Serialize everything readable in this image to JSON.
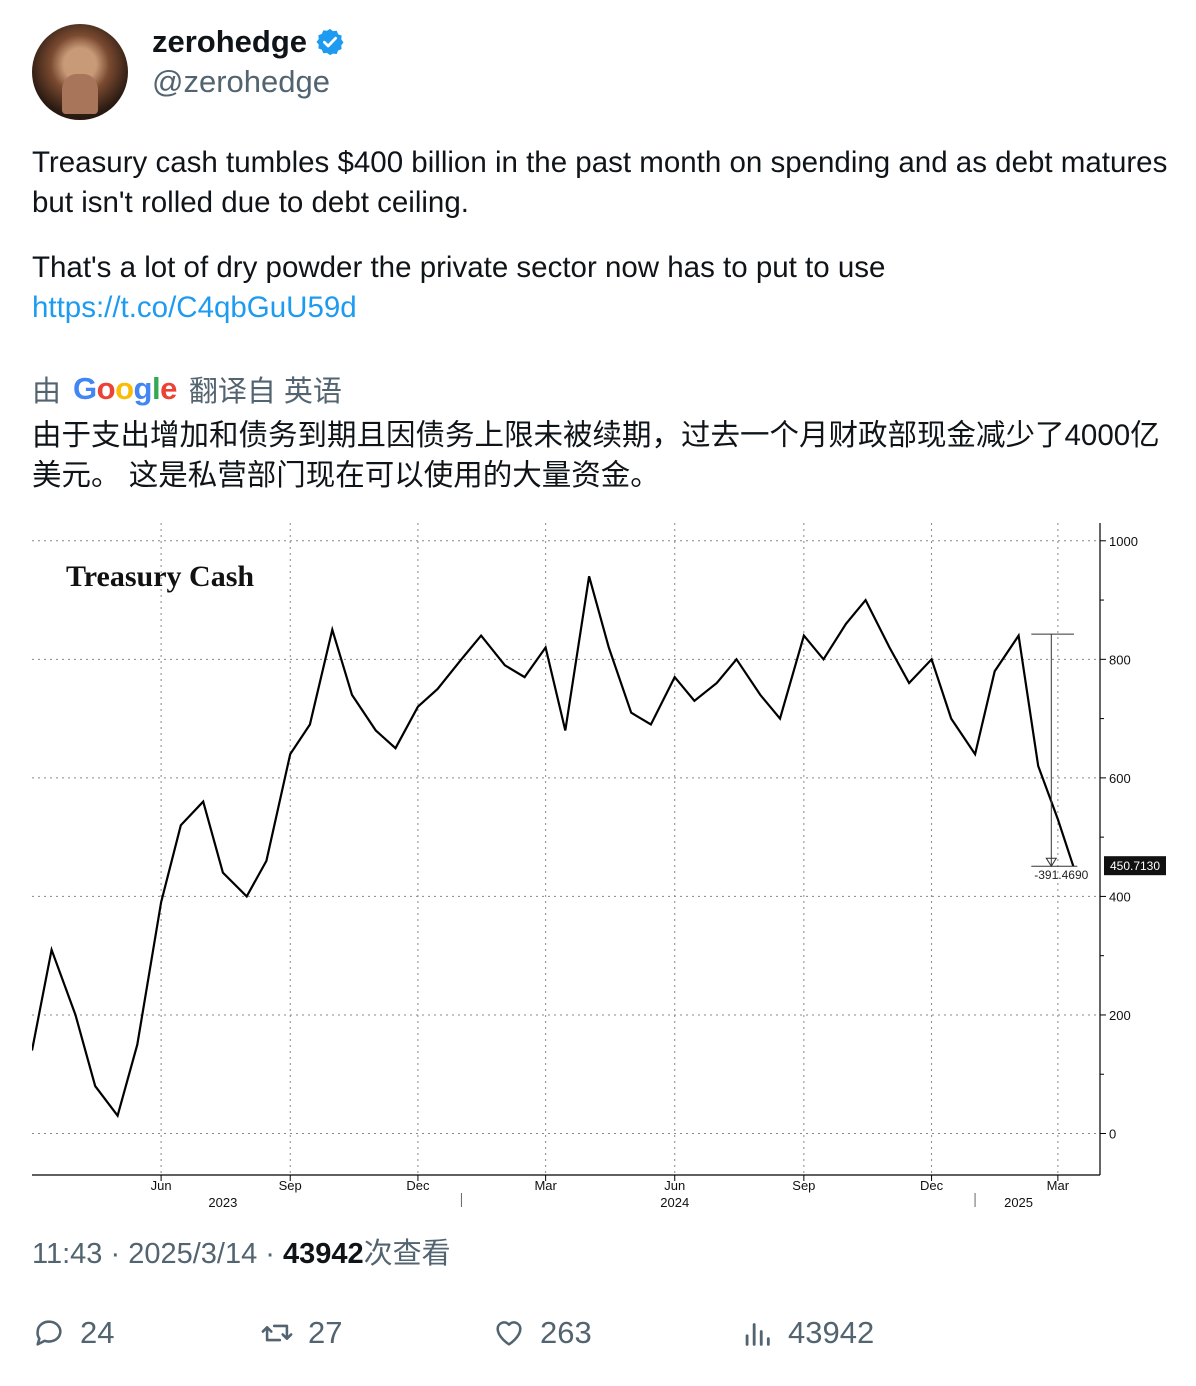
{
  "author": {
    "display_name": "zerohedge",
    "handle": "@zerohedge",
    "verified_color": "#1d9bf0"
  },
  "tweet": {
    "text_p1": "Treasury cash tumbles $400 billion in the past month on spending and as debt matures but isn't rolled due to debt ceiling.",
    "text_p2": "That's a lot of dry powder the private sector now has to put to use",
    "link": "https://t.co/C4qbGuU59d"
  },
  "translation": {
    "prefix": "由",
    "provider": "Google",
    "suffix": "翻译自 英语",
    "text": "由于支出增加和债务到期且因债务上限未被续期，过去一个月财政部现金减少了4000亿美元。 这是私营部门现在可以使用的大量资金。"
  },
  "meta": {
    "time": "11:43",
    "date": "2025/3/14",
    "views": "43942",
    "views_label": "次查看"
  },
  "actions": {
    "replies": "24",
    "retweets": "27",
    "likes": "263",
    "views": "43942"
  },
  "chart_data": {
    "type": "line",
    "title": "Treasury Cash",
    "ylim": [
      -70,
      1030
    ],
    "y_ticks": [
      0,
      200,
      400,
      600,
      800,
      1000
    ],
    "grid": true,
    "x_month_labels": [
      "Jun",
      "Sep",
      "Dec",
      "Mar",
      "Jun",
      "Sep",
      "Dec",
      "Mar"
    ],
    "x_year_labels": [
      "2023",
      "2024",
      "2025"
    ],
    "series": [
      {
        "x": [
          "2023-03-01",
          "2023-03-15",
          "2023-04-01",
          "2023-04-15",
          "2023-05-01",
          "2023-05-15",
          "2023-06-01",
          "2023-06-15",
          "2023-07-01",
          "2023-07-15",
          "2023-08-01",
          "2023-08-15",
          "2023-09-01",
          "2023-09-15",
          "2023-10-01",
          "2023-10-15",
          "2023-11-01",
          "2023-11-15",
          "2023-12-01",
          "2023-12-15",
          "2024-01-01",
          "2024-01-15",
          "2024-02-01",
          "2024-02-15",
          "2024-03-01",
          "2024-03-15",
          "2024-04-01",
          "2024-04-15",
          "2024-05-01",
          "2024-05-15",
          "2024-06-01",
          "2024-06-15",
          "2024-07-01",
          "2024-07-15",
          "2024-08-01",
          "2024-08-15",
          "2024-09-01",
          "2024-09-15",
          "2024-10-01",
          "2024-10-15",
          "2024-11-01",
          "2024-11-15",
          "2024-12-01",
          "2024-12-15",
          "2025-01-01",
          "2025-01-15",
          "2025-02-01",
          "2025-02-15",
          "2025-03-01",
          "2025-03-12"
        ],
        "values": [
          140,
          310,
          200,
          80,
          30,
          150,
          390,
          520,
          560,
          440,
          400,
          460,
          640,
          690,
          850,
          740,
          680,
          650,
          720,
          750,
          800,
          840,
          790,
          770,
          820,
          680,
          940,
          820,
          710,
          690,
          770,
          730,
          760,
          800,
          740,
          700,
          840,
          800,
          860,
          900,
          820,
          760,
          800,
          700,
          640,
          780,
          840,
          620,
          530,
          451
        ]
      }
    ],
    "annotations": {
      "last_value": "450.7130",
      "change": "-391.4690"
    }
  }
}
